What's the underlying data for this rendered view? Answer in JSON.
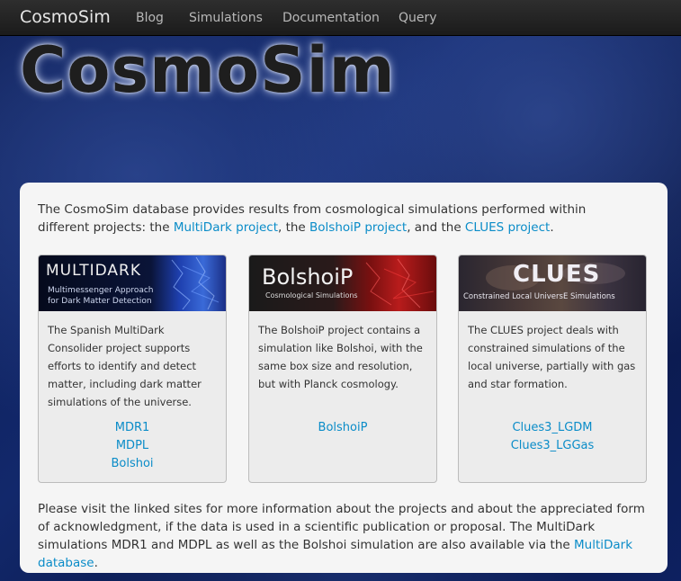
{
  "navbar": {
    "brand": "CosmoSim",
    "links": [
      "Blog",
      "Simulations",
      "Documentation",
      "Query"
    ]
  },
  "hero": {
    "title": "CosmoSim"
  },
  "intro": {
    "t1": "The CosmoSim database provides results from cosmological simulations performed within different projects: the ",
    "link_multidark": "MultiDark project",
    "t2": ", the ",
    "link_bolshoip": "BolshoiP project",
    "t3": ", and the ",
    "link_clues": "CLUES project",
    "t4": "."
  },
  "cards": {
    "multidark": {
      "banner_title": "MULTIDARK",
      "banner_sub1": "Multimessenger Approach",
      "banner_sub2": "for Dark Matter Detection",
      "description": "The Spanish MultiDark Consolider project supports efforts to identify and detect matter, including dark matter simulations of the universe.",
      "links": [
        "MDR1",
        "MDPL",
        "Bolshoi"
      ]
    },
    "bolshoip": {
      "banner_title": "BolshoiP",
      "banner_sub": "Cosmological Simulations",
      "description": "The BolshoiP project contains a simulation like Bolshoi, with the same box size and resolution, but with Planck cosmology.",
      "links": [
        "BolshoiP"
      ]
    },
    "clues": {
      "banner_title": "CLUES",
      "banner_sub": "Constrained Local UniversE Simulations",
      "description": "The CLUES project deals with constrained simulations of the local universe, partially with gas and star formation.",
      "links": [
        "Clues3_LGDM",
        "Clues3_LGGas"
      ]
    }
  },
  "outro": {
    "t1": "Please visit the linked sites for more information about the projects and about the appreciated form of acknowledgment, if the data is used in a scientific publication or proposal. The MultiDark simulations MDR1 and MDPL as well as the Bolshoi simulation are also available via the ",
    "link": "MultiDark database",
    "t2": "."
  }
}
